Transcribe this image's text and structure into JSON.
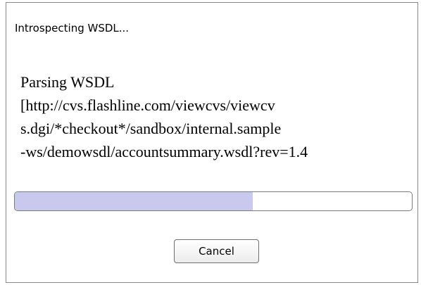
{
  "dialog": {
    "title": "Introspecting WSDL...",
    "message_lines": [
      "Parsing WSDL",
      "[http://cvs.flashline.com/viewcvs/viewcv",
      "s.dgi/*checkout*/sandbox/internal.sample",
      "-ws/demowsdl/accountsummary.wsdl?rev=1.4"
    ],
    "progress": {
      "fraction": 0.6,
      "fill_color": "#c9c8ef"
    },
    "cancel_label": "Cancel"
  }
}
